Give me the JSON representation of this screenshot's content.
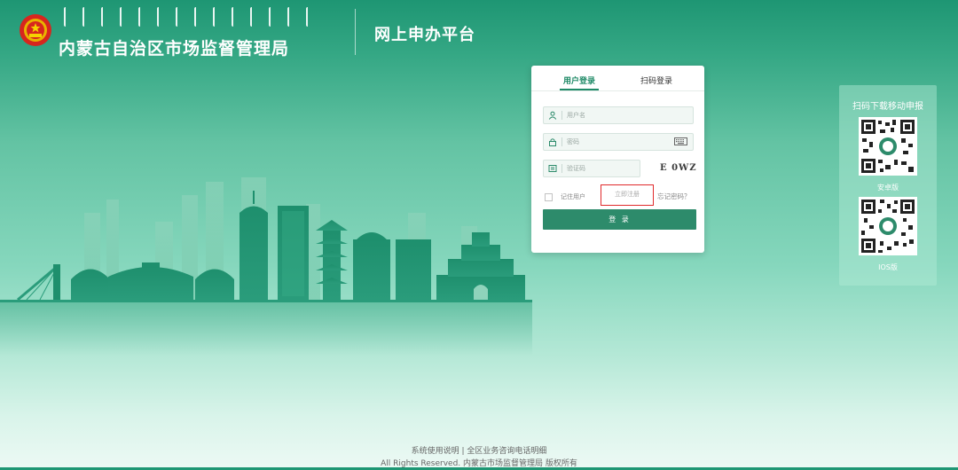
{
  "header": {
    "bureau_name": "内蒙古自治区市场监督管理局",
    "platform_name": "网上申办平台"
  },
  "login": {
    "tabs": [
      {
        "label": "用户登录",
        "active": true
      },
      {
        "label": "扫码登录",
        "active": false
      }
    ],
    "username_placeholder": "用户名",
    "password_placeholder": "密码",
    "captcha_placeholder": "验证码",
    "captcha_text": "E 0WZ",
    "remember_label": "记住用户",
    "register_link": "立即注册",
    "forgot_link": "忘记密码？",
    "submit_label": "登 录"
  },
  "qr_panel": {
    "title": "扫码下载移动申报",
    "android_label": "安卓版",
    "ios_label": "IOS版"
  },
  "footer": {
    "links": "系统使用说明 | 全区业务咨询电话明细",
    "copyright": "All Rights Reserved. 内蒙古市场监督管理局 版权所有"
  },
  "colors": {
    "brand_green": "#2d8b6b",
    "highlight_red": "#e0292b"
  }
}
